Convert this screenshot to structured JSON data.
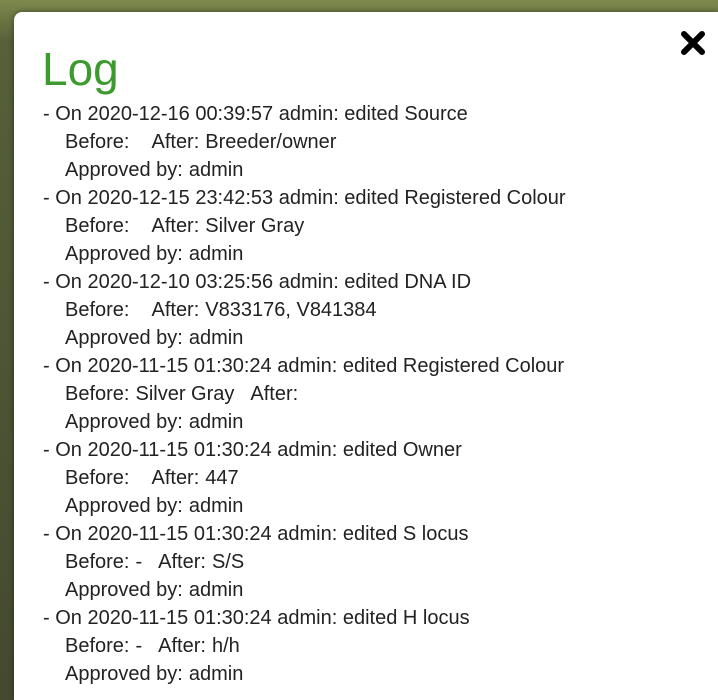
{
  "dialog": {
    "title": "Log",
    "close_icon": "close-x-icon"
  },
  "labels": {
    "before": "Before:",
    "after": "After:",
    "approved_by": "Approved by:"
  },
  "log_entries": [
    {
      "header": "- On 2020-12-16 00:39:57 admin: edited Source",
      "before": "",
      "after": "Breeder/owner",
      "approved_by": "admin"
    },
    {
      "header": "- On 2020-12-15 23:42:53 admin: edited Registered Colour",
      "before": "",
      "after": "Silver Gray",
      "approved_by": "admin"
    },
    {
      "header": "- On 2020-12-10 03:25:56 admin: edited DNA ID",
      "before": "",
      "after": "V833176, V841384",
      "approved_by": "admin"
    },
    {
      "header": "- On 2020-11-15 01:30:24 admin: edited Registered Colour",
      "before": "Silver Gray",
      "after": "",
      "approved_by": "admin"
    },
    {
      "header": "- On 2020-11-15 01:30:24 admin: edited Owner",
      "before": "",
      "after": "447",
      "approved_by": "admin"
    },
    {
      "header": "- On 2020-11-15 01:30:24 admin: edited S locus",
      "before": "-",
      "after": "S/S",
      "approved_by": "admin"
    },
    {
      "header": "- On 2020-11-15 01:30:24 admin: edited H locus",
      "before": "-",
      "after": "h/h",
      "approved_by": "admin"
    }
  ],
  "scrollbar": {
    "up_icon": "chevron-up-icon",
    "down_icon": "chevron-down-icon"
  }
}
